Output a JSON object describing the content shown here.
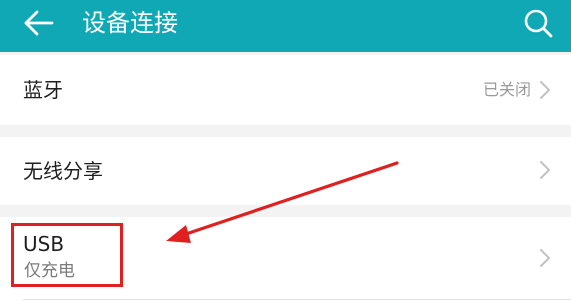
{
  "header": {
    "title": "设备连接",
    "back_icon": "back-arrow-icon",
    "search_icon": "search-icon",
    "color": "#0fa8b4"
  },
  "settings": {
    "bluetooth": {
      "label": "蓝牙",
      "status": "已关闭"
    },
    "wireless_share": {
      "label": "无线分享"
    },
    "usb": {
      "label": "USB",
      "status": "仅充电"
    }
  },
  "annotation": {
    "color": "#e02020",
    "box_target": "usb",
    "arrow_target": "usb"
  }
}
